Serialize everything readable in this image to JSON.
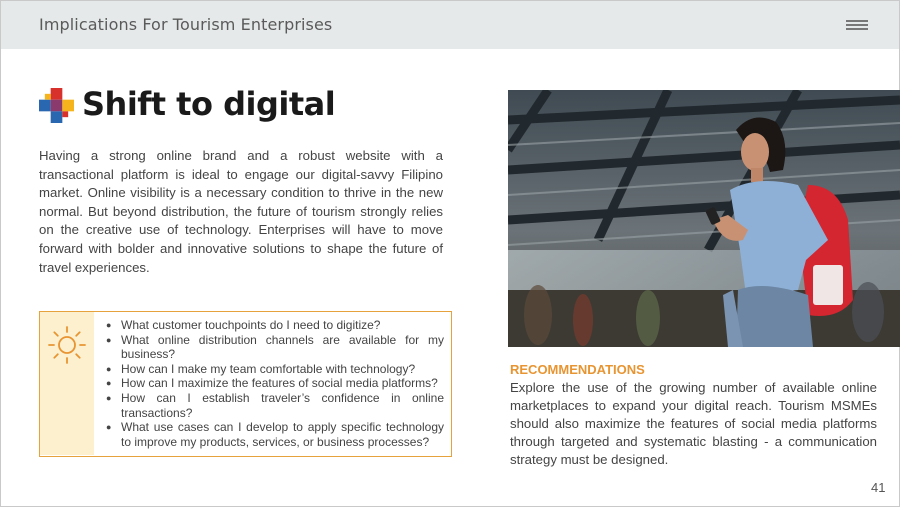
{
  "header": {
    "title": "Implications For Tourism Enterprises",
    "menu_icon": "hamburger-menu-icon"
  },
  "section": {
    "icon": "colored-cross-logo-icon",
    "title": "Shift to digital",
    "body": "Having a strong online brand and a robust website with a transactional platform is ideal to engage our digital-savvy Filipino market.  Online visibility is a necessary condition to thrive in the new normal. But beyond distribution, the future of tourism strongly relies on the creative use of technology. Enterprises will have to move forward with bolder and innovative solutions to shape the future of travel experiences."
  },
  "questions": {
    "icon": "sun-icon",
    "items": [
      "What customer touchpoints do I need to digitize?",
      "What online distribution channels are available for my business?",
      "How can I make my team comfortable with technology?",
      "How can I maximize the features of social media platforms?",
      "How can I establish traveler’s confidence in online transactions?",
      "What use cases can I develop to apply specific technology to improve my products, services, or business processes?"
    ]
  },
  "photo": {
    "icon": "woman-with-smartphone-photo"
  },
  "recommendations": {
    "heading": "RECOMMENDATIONS",
    "text": "Explore the use of the growing number of available online marketplaces to expand your digital reach. Tourism MSMEs should also maximize the features of social media platforms through targeted and systematic blasting - a communication strategy must be designed."
  },
  "page_number": "41",
  "colors": {
    "header_bg": "#e6e9ea",
    "accent_orange": "#e89431",
    "box_border": "#e6a23c",
    "box_side": "#fdf0cf",
    "logo_red": "#d8312c",
    "logo_yellow": "#f5b41c",
    "logo_blue": "#2a67b1"
  }
}
